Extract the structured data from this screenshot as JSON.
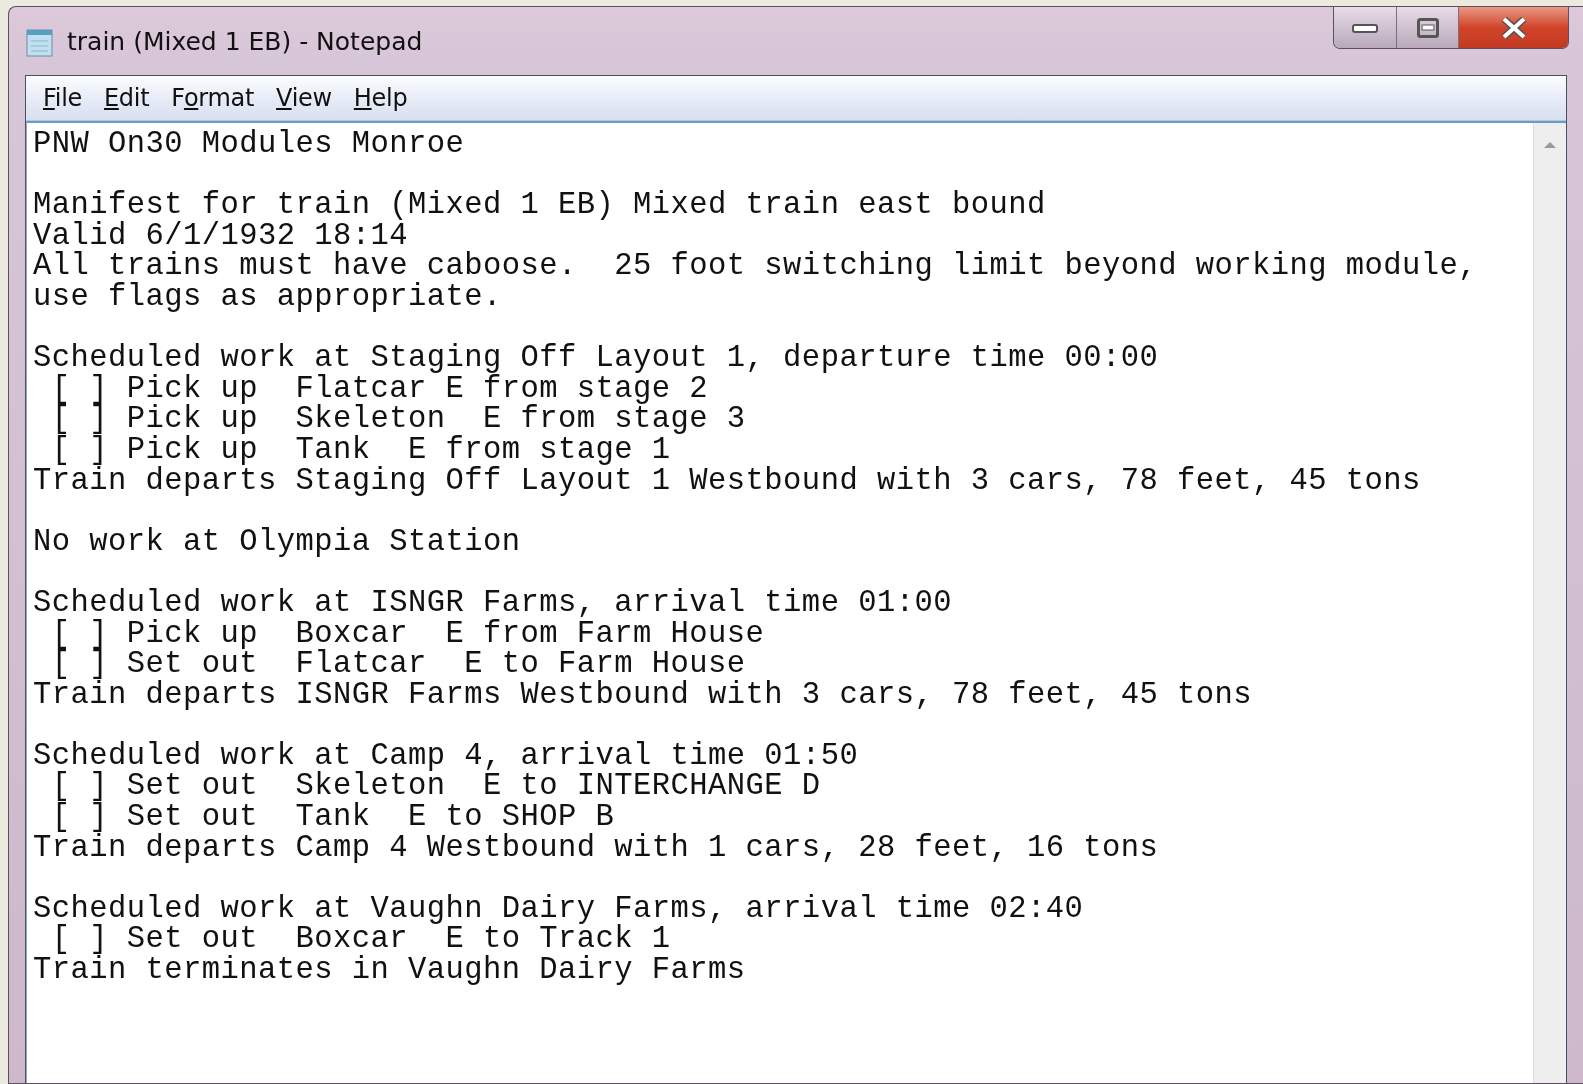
{
  "window": {
    "title": "train (Mixed 1 EB) - Notepad"
  },
  "menu": [
    {
      "access_key": "F",
      "text_after": "ile"
    },
    {
      "access_key": "E",
      "text_after": "dit"
    },
    {
      "text_before": "F",
      "access_key": "o",
      "text_after": "rmat"
    },
    {
      "access_key": "V",
      "text_after": "iew"
    },
    {
      "access_key": "H",
      "text_after": "elp"
    }
  ],
  "document": {
    "paragraphs": [
      [
        "PNW On30 Modules Monroe"
      ],
      [
        "Manifest for train (Mixed 1 EB) Mixed train east bound",
        "Valid 6/1/1932 18:14",
        "All trains must have caboose.  25 foot switching limit beyond working module,",
        "use flags as appropriate."
      ],
      [
        "Scheduled work at Staging Off Layout 1, departure time 00:00",
        " [ ] Pick up  Flatcar E from stage 2",
        " [ ] Pick up  Skeleton  E from stage 3",
        " [ ] Pick up  Tank  E from stage 1",
        "Train departs Staging Off Layout 1 Westbound with 3 cars, 78 feet, 45 tons"
      ],
      [
        "No work at Olympia Station"
      ],
      [
        "Scheduled work at ISNGR Farms, arrival time 01:00",
        " [ ] Pick up  Boxcar  E from Farm House",
        " [ ] Set out  Flatcar  E to Farm House",
        "Train departs ISNGR Farms Westbound with 3 cars, 78 feet, 45 tons"
      ],
      [
        "Scheduled work at Camp 4, arrival time 01:50",
        " [ ] Set out  Skeleton  E to INTERCHANGE D",
        " [ ] Set out  Tank  E to SHOP B",
        "Train departs Camp 4 Westbound with 1 cars, 28 feet, 16 tons"
      ],
      [
        "Scheduled work at Vaughn Dairy Farms, arrival time 02:40",
        " [ ] Set out  Boxcar  E to Track 1",
        "Train terminates in Vaughn Dairy Farms"
      ]
    ]
  }
}
